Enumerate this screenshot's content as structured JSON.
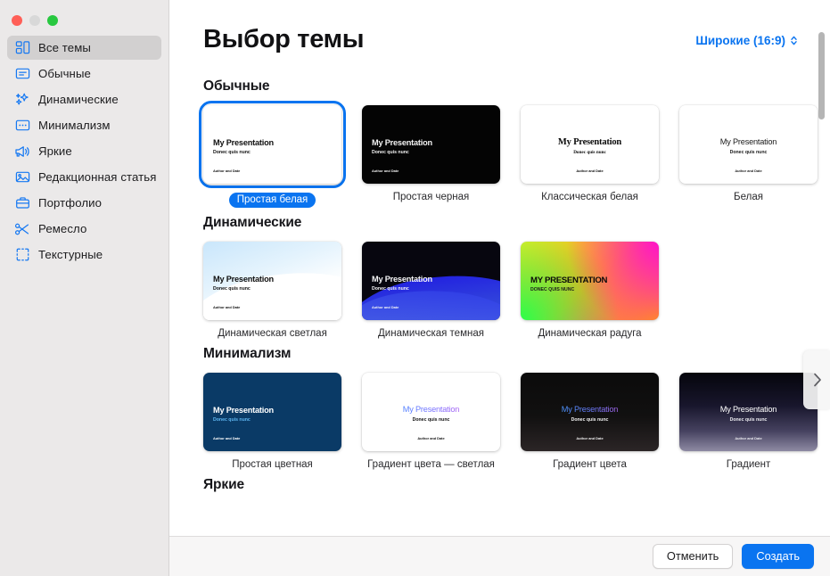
{
  "window": {
    "traffic_lights": [
      "close",
      "minimize",
      "maximize"
    ]
  },
  "sidebar": {
    "items": [
      {
        "label": "Все темы",
        "icon": "all-themes-icon",
        "selected": true
      },
      {
        "label": "Обычные",
        "icon": "basic-icon",
        "selected": false
      },
      {
        "label": "Динамические",
        "icon": "sparkles-icon",
        "selected": false
      },
      {
        "label": "Минимализм",
        "icon": "dots-box-icon",
        "selected": false
      },
      {
        "label": "Яркие",
        "icon": "megaphone-icon",
        "selected": false
      },
      {
        "label": "Редакционная статья",
        "icon": "photo-icon",
        "selected": false
      },
      {
        "label": "Портфолио",
        "icon": "briefcase-icon",
        "selected": false
      },
      {
        "label": "Ремесло",
        "icon": "scissors-icon",
        "selected": false
      },
      {
        "label": "Текстурные",
        "icon": "crop-frame-icon",
        "selected": false
      }
    ]
  },
  "header": {
    "title": "Выбор темы",
    "aspect_ratio": "Широкие (16:9)",
    "accent_color": "#0a74f0"
  },
  "thumbnail_text": {
    "title": "My Presentation",
    "subtitle": "Donec quis nunc",
    "author": "Author and Date",
    "title_upper": "MY PRESENTATION",
    "subtitle_upper": "DONEC QUIS NUNC"
  },
  "sections": [
    {
      "title": "Обычные",
      "themes": [
        {
          "name": "Простая белая",
          "selected": true,
          "style": "th-white",
          "centered": false
        },
        {
          "name": "Простая черная",
          "selected": false,
          "style": "th-black",
          "centered": false
        },
        {
          "name": "Классическая белая",
          "selected": false,
          "style": "th-classic",
          "centered": true
        },
        {
          "name": "Белая",
          "selected": false,
          "style": "th-plainwhite",
          "centered": true
        }
      ]
    },
    {
      "title": "Динамические",
      "themes": [
        {
          "name": "Динамическая светлая",
          "selected": false,
          "style": "th-dynlight",
          "centered": false
        },
        {
          "name": "Динамическая темная",
          "selected": false,
          "style": "th-dyndark",
          "centered": false
        },
        {
          "name": "Динамическая радуга",
          "selected": false,
          "style": "th-rainbow",
          "centered": false
        }
      ]
    },
    {
      "title": "Минимализм",
      "themes": [
        {
          "name": "Простая цветная",
          "selected": false,
          "style": "th-navy",
          "centered": false
        },
        {
          "name": "Градиент цвета — светлая",
          "selected": false,
          "style": "th-gradlight",
          "centered": true
        },
        {
          "name": "Градиент цвета",
          "selected": false,
          "style": "th-graddark",
          "centered": true
        },
        {
          "name": "Градиент",
          "selected": false,
          "style": "th-grad",
          "centered": true
        }
      ]
    },
    {
      "title": "Яркие",
      "themes": []
    }
  ],
  "footer": {
    "cancel_label": "Отменить",
    "create_label": "Создать"
  }
}
